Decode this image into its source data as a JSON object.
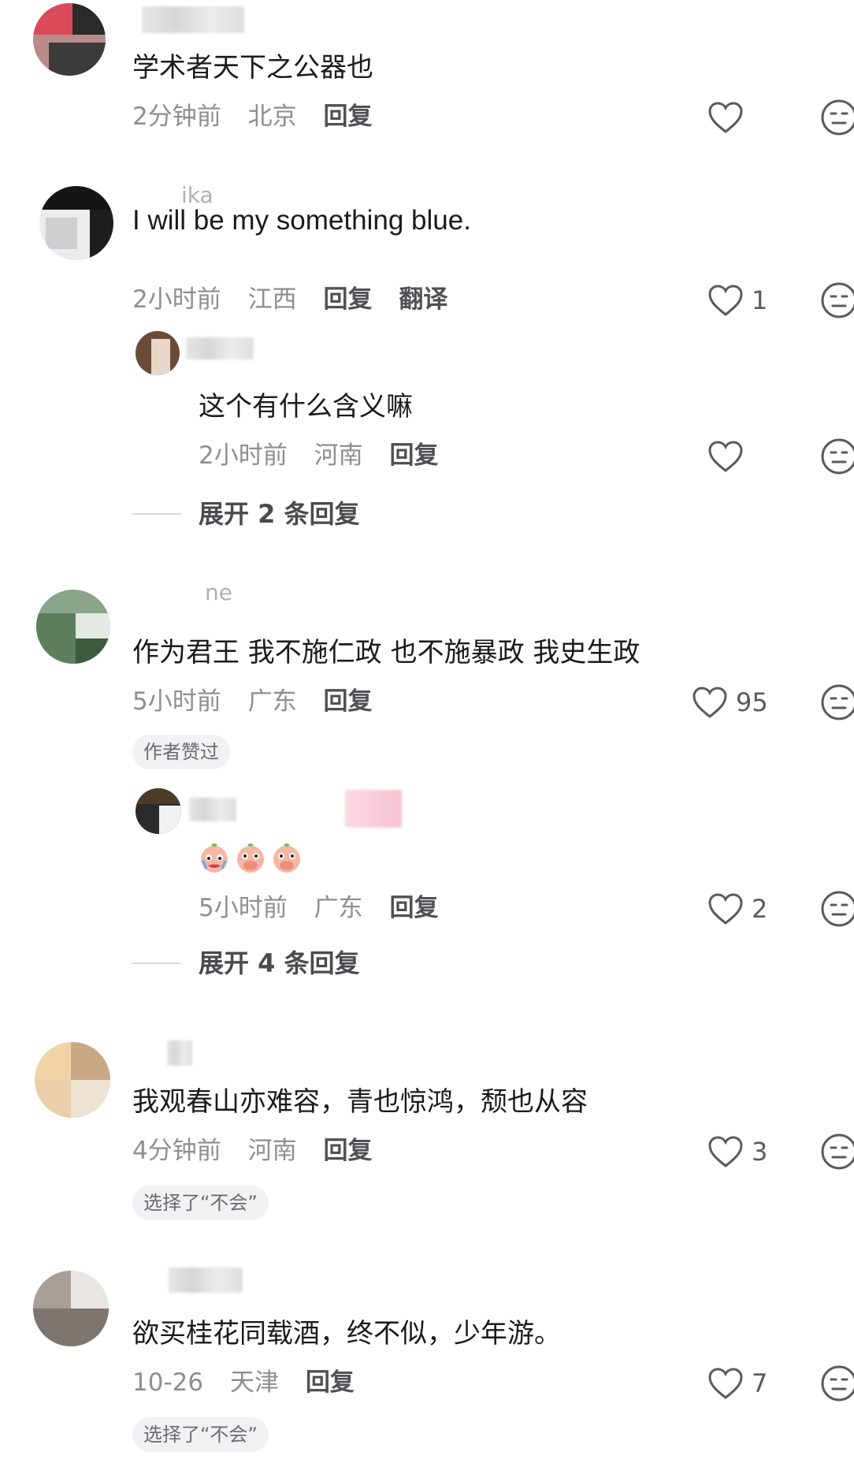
{
  "comments": [
    {
      "content": "学术者天下之公器也",
      "time": "2分钟前",
      "location": "北京",
      "reply_label": "回复",
      "like_count": ""
    },
    {
      "username_fragment": "ika",
      "content": "I will be my something blue.",
      "time": "2小时前",
      "location": "江西",
      "reply_label": "回复",
      "translate_label": "翻译",
      "like_count": "1",
      "reply": {
        "content": "这个有什么含义嘛",
        "time": "2小时前",
        "location": "河南",
        "reply_label": "回复",
        "like_count": ""
      },
      "expand_label": "展开 2 条回复"
    },
    {
      "username_fragment": "ne",
      "content": "作为君王 我不施仁政 也不施暴政 我史生政",
      "time": "5小时前",
      "location": "广东",
      "reply_label": "回复",
      "like_count": "95",
      "badge": "作者赞过",
      "reply": {
        "time": "5小时前",
        "location": "广东",
        "reply_label": "回复",
        "like_count": "2",
        "emoji": [
          "crying-face",
          "hand-over-mouth-face",
          "hand-over-mouth-face"
        ]
      },
      "expand_label": "展开 4 条回复"
    },
    {
      "content": "我观春山亦难容，青也惊鸿，颓也从容",
      "time": "4分钟前",
      "location": "河南",
      "reply_label": "回复",
      "like_count": "3",
      "badge": "选择了“不会”"
    },
    {
      "content": "欲买桂花同载酒，终不似，少年游。",
      "time": "10-26",
      "location": "天津",
      "reply_label": "回复",
      "like_count": "7",
      "badge": "选择了“不会”"
    }
  ],
  "colors": {
    "text": "#1b1b1d",
    "meta": "#8e8e93",
    "action": "#505055",
    "badge_bg": "#f2f2f4",
    "icon": "#5a5a5f"
  }
}
